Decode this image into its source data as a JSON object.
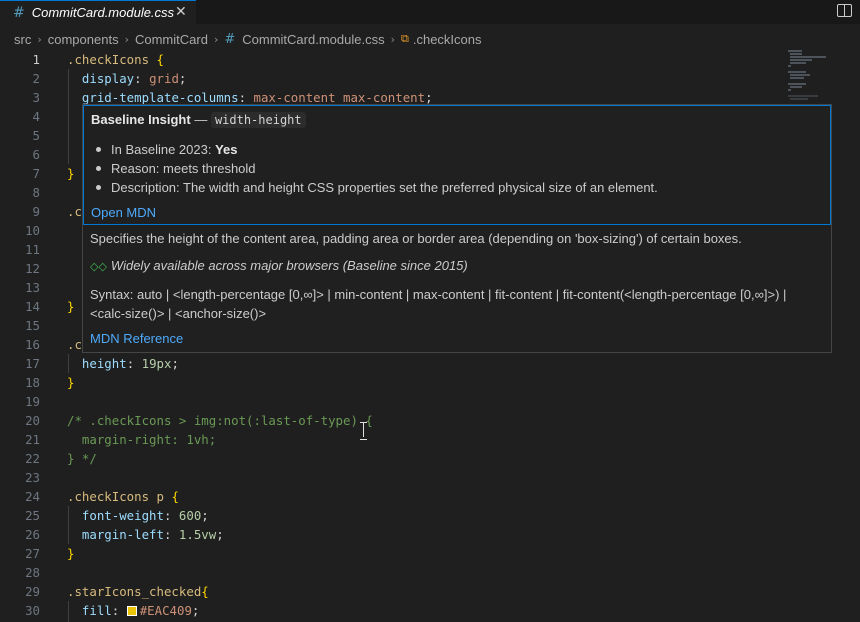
{
  "tab": {
    "icon": "css-hash-icon",
    "icon_glyph": "#",
    "title": "CommitCard.module.css",
    "close_glyph": "✕"
  },
  "breadcrumb": {
    "items": [
      "src",
      "components",
      "CommitCard",
      "CommitCard.module.css",
      ".checkIcons"
    ],
    "sep": "›",
    "symbol_glyph": "⧉"
  },
  "editor": {
    "lines": [
      {
        "n": "1",
        "tokens": [
          {
            "t": ".checkIcons",
            "c": "sel"
          },
          {
            "t": " ",
            "c": "punc"
          },
          {
            "t": "{",
            "c": "br"
          }
        ]
      },
      {
        "n": "2",
        "tokens": [
          {
            "t": "  ",
            "c": "punc"
          },
          {
            "t": "display",
            "c": "prop"
          },
          {
            "t": ": ",
            "c": "punc"
          },
          {
            "t": "grid",
            "c": "val"
          },
          {
            "t": ";",
            "c": "punc"
          }
        ]
      },
      {
        "n": "3",
        "tokens": [
          {
            "t": "  ",
            "c": "punc"
          },
          {
            "t": "grid-template-columns",
            "c": "prop"
          },
          {
            "t": ": ",
            "c": "punc"
          },
          {
            "t": "max-content max-content",
            "c": "val"
          },
          {
            "t": ";",
            "c": "punc"
          }
        ]
      },
      {
        "n": "4",
        "tokens": []
      },
      {
        "n": "5",
        "tokens": []
      },
      {
        "n": "6",
        "tokens": []
      },
      {
        "n": "7",
        "tokens": [
          {
            "t": "}",
            "c": "br"
          }
        ]
      },
      {
        "n": "8",
        "tokens": []
      },
      {
        "n": "9",
        "tokens": [
          {
            "t": ".c",
            "c": "sel"
          }
        ]
      },
      {
        "n": "10",
        "tokens": []
      },
      {
        "n": "11",
        "tokens": []
      },
      {
        "n": "12",
        "tokens": []
      },
      {
        "n": "13",
        "tokens": []
      },
      {
        "n": "14",
        "tokens": [
          {
            "t": "}",
            "c": "br"
          }
        ]
      },
      {
        "n": "15",
        "tokens": []
      },
      {
        "n": "16",
        "tokens": [
          {
            "t": ".c",
            "c": "sel"
          }
        ]
      },
      {
        "n": "17",
        "tokens": [
          {
            "t": "  ",
            "c": "punc"
          },
          {
            "t": "height",
            "c": "prop"
          },
          {
            "t": ": ",
            "c": "punc"
          },
          {
            "t": "19px",
            "c": "num"
          },
          {
            "t": ";",
            "c": "punc"
          }
        ]
      },
      {
        "n": "18",
        "tokens": [
          {
            "t": "}",
            "c": "br"
          }
        ]
      },
      {
        "n": "19",
        "tokens": []
      },
      {
        "n": "20",
        "tokens": [
          {
            "t": "/* .checkIcons > img:not(:last-of-type) {",
            "c": "cmt"
          }
        ]
      },
      {
        "n": "21",
        "tokens": [
          {
            "t": "  margin-right: 1vh;",
            "c": "cmt"
          }
        ]
      },
      {
        "n": "22",
        "tokens": [
          {
            "t": "} */",
            "c": "cmt"
          }
        ]
      },
      {
        "n": "23",
        "tokens": []
      },
      {
        "n": "24",
        "tokens": [
          {
            "t": ".checkIcons p",
            "c": "sel"
          },
          {
            "t": " ",
            "c": "punc"
          },
          {
            "t": "{",
            "c": "br"
          }
        ]
      },
      {
        "n": "25",
        "tokens": [
          {
            "t": "  ",
            "c": "punc"
          },
          {
            "t": "font-weight",
            "c": "prop"
          },
          {
            "t": ": ",
            "c": "punc"
          },
          {
            "t": "600",
            "c": "num"
          },
          {
            "t": ";",
            "c": "punc"
          }
        ]
      },
      {
        "n": "26",
        "tokens": [
          {
            "t": "  ",
            "c": "punc"
          },
          {
            "t": "margin-left",
            "c": "prop"
          },
          {
            "t": ": ",
            "c": "punc"
          },
          {
            "t": "1.5vw",
            "c": "num"
          },
          {
            "t": ";",
            "c": "punc"
          }
        ]
      },
      {
        "n": "27",
        "tokens": [
          {
            "t": "}",
            "c": "br"
          }
        ]
      },
      {
        "n": "28",
        "tokens": []
      },
      {
        "n": "29",
        "tokens": [
          {
            "t": ".starIcons_checked",
            "c": "sel"
          },
          {
            "t": "{",
            "c": "br"
          }
        ]
      },
      {
        "n": "30",
        "tokens": [
          {
            "t": "  ",
            "c": "punc"
          },
          {
            "t": "fill",
            "c": "prop"
          },
          {
            "t": ": ",
            "c": "punc"
          },
          {
            "t": "",
            "c": "swatch",
            "color": "#EAC409"
          },
          {
            "t": "#EAC409",
            "c": "val"
          },
          {
            "t": ";",
            "c": "punc"
          }
        ]
      }
    ],
    "active_line": "1"
  },
  "hover": {
    "baseline_title": "Baseline Insight",
    "dash": " — ",
    "feature": "width-height",
    "bullets": [
      {
        "label": "In Baseline 2023: ",
        "value": "Yes"
      },
      {
        "label": "Reason: meets threshold",
        "value": ""
      },
      {
        "label": "Description: The width and height CSS properties set the preferred physical size of an element.",
        "value": ""
      }
    ],
    "open_mdn": "Open MDN",
    "description": "Specifies the height of the content area, padding area or border area (depending on 'box-sizing') of certain boxes.",
    "availability_icon": "◇◇",
    "availability": "Widely available across major browsers (Baseline since 2015)",
    "syntax": "Syntax: auto | <length-percentage [0,∞]> | min-content | max-content | fit-content | fit-content(<length-percentage [0,∞]>) | <calc-size()> | <anchor-size()>",
    "mdn_reference": "MDN Reference"
  },
  "colors": {
    "accent": "#0078d4",
    "link": "#4daafc",
    "swatch": "#EAC409"
  }
}
